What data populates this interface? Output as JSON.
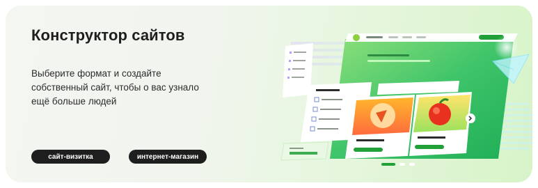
{
  "banner": {
    "title": "Конструктор сайтов",
    "subtitle_lines": [
      "Выберите формат и создайте",
      "собственный сайт, чтобы о вас узнало",
      "ещё больше людей"
    ],
    "buttons": [
      {
        "label": "сайт-визитка"
      },
      {
        "label": "интернет-магазин"
      }
    ]
  },
  "illustration": {
    "icons": [
      "apple-icon",
      "fruit-slice-icon",
      "chevron-right-icon",
      "paper-plane-icon"
    ],
    "accent_color": "#21a038",
    "gradient_colors": [
      "#7ee06a",
      "#3bc47d",
      "#a6e9ff",
      "#c9b8f5"
    ]
  }
}
